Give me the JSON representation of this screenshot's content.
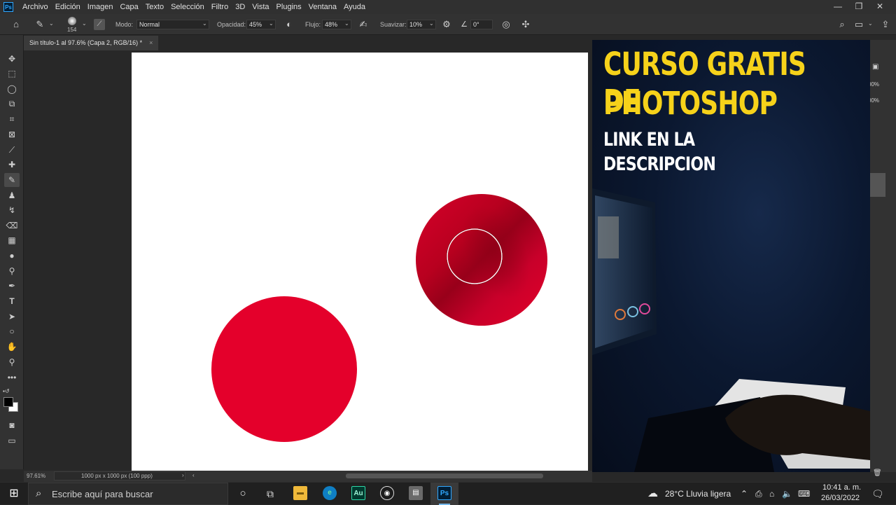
{
  "app": {
    "logo": "Ps",
    "menu": [
      "Archivo",
      "Edición",
      "Imagen",
      "Capa",
      "Texto",
      "Selección",
      "Filtro",
      "3D",
      "Vista",
      "Plugins",
      "Ventana",
      "Ayuda"
    ]
  },
  "options": {
    "brush_size": "154",
    "mode_label": "Modo:",
    "mode_value": "Normal",
    "opacity_label": "Opacidad:",
    "opacity_value": "45%",
    "flow_label": "Flujo:",
    "flow_value": "48%",
    "smoothing_label": "Suavizar:",
    "smoothing_value": "10%",
    "angle_value": "0°"
  },
  "document": {
    "tab_title": "Sin título-1 al 97.6% (Capa 2, RGB/16) *",
    "close": "×",
    "zoom": "97.61%",
    "doc_info": "1000 px x 1000 px (100 ppp)",
    "circle_color": "#e4002b"
  },
  "promo": {
    "line1": "CURSO GRATIS DE",
    "line2": "PHOTOSHOP",
    "line3": "LINK EN LA",
    "line4": "DESCRIPCION"
  },
  "right_panel": {
    "pct1": "00%",
    "pct2": "00%"
  },
  "taskbar": {
    "search_placeholder": "Escribe aquí para buscar",
    "apps": [
      "explorer-icon",
      "edge-icon",
      "audition-icon",
      "obs-icon",
      "stack-icon",
      "photoshop-icon"
    ],
    "weather": "28°C  Lluvia ligera",
    "time": "10:41 a. m.",
    "date": "26/03/2022"
  }
}
